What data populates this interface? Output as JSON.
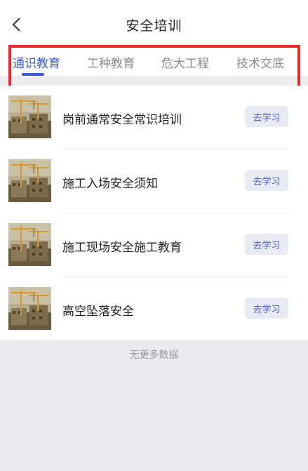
{
  "header": {
    "title": "安全培训"
  },
  "tabs": [
    {
      "label": "通识教育",
      "active": true
    },
    {
      "label": "工种教育",
      "active": false
    },
    {
      "label": "危大工程",
      "active": false
    },
    {
      "label": "技术交底",
      "active": false
    }
  ],
  "list": {
    "items": [
      {
        "title": "岗前通常安全常识培训",
        "action": "去学习"
      },
      {
        "title": "施工入场安全须知",
        "action": "去学习"
      },
      {
        "title": "施工现场安全施工教育",
        "action": "去学习"
      },
      {
        "title": "高空坠落安全",
        "action": "去学习"
      }
    ],
    "footer": "无更多数据"
  },
  "colors": {
    "accent": "#3f5bd6",
    "highlight": "#f0262a",
    "button_bg": "#e9ebf4",
    "page_bg": "#e9e9ee"
  },
  "icons": {
    "back": "chevron-left-icon",
    "thumbnail": "construction-site-thumbnail"
  }
}
